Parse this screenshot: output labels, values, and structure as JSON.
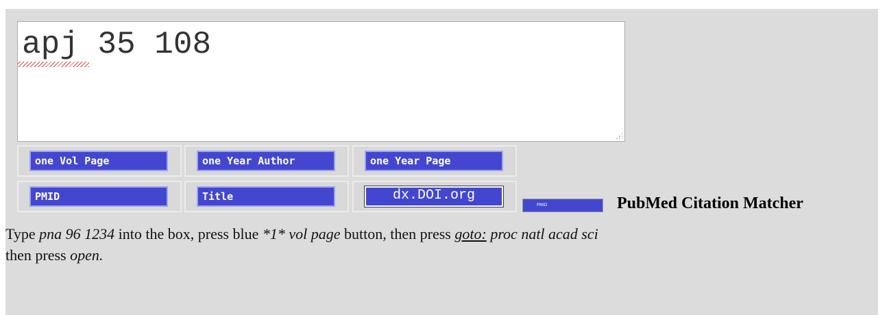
{
  "query": {
    "value": "apj 35 108"
  },
  "buttons": {
    "row1": [
      "one Vol Page",
      "one Year Author",
      "one Year Page"
    ],
    "row2": [
      "PMID",
      "Title",
      "dx.DOI.org"
    ],
    "pmid_small": "PMID"
  },
  "matcher_label": "PubMed Citation Matcher",
  "instructions": {
    "t1": "Type ",
    "i1": "pna 96 1234",
    "t2": " into the box, press blue ",
    "i2": "*1* vol page",
    "t3": " button, then press ",
    "u1": "goto:",
    "i3": " proc natl acad sci",
    "t4": "then press ",
    "i4": "open."
  }
}
